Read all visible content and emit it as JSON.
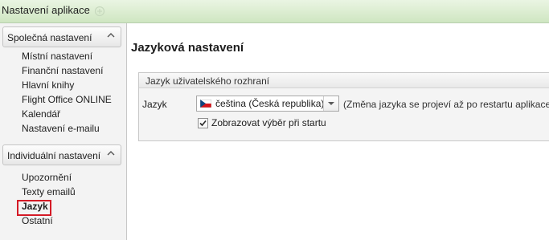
{
  "window": {
    "title": "Nastavení aplikace"
  },
  "sidebar": {
    "groups": [
      {
        "title": "Společná nastavení",
        "items": [
          {
            "label": "Místní nastavení"
          },
          {
            "label": "Finanční nastavení"
          },
          {
            "label": "Hlavní knihy"
          },
          {
            "label": "Flight Office ONLINE"
          },
          {
            "label": "Kalendář"
          },
          {
            "label": "Nastavení e-mailu"
          }
        ]
      },
      {
        "title": "Individuální nastavení",
        "items": [
          {
            "label": "Upozornění"
          },
          {
            "label": "Texty emailů"
          },
          {
            "label": "Jazyk",
            "selected": true
          },
          {
            "label": "Ostatní"
          }
        ]
      }
    ]
  },
  "main": {
    "title": "Jazyková nastavení",
    "panel": {
      "title": "Jazyk uživatelského rozhraní",
      "language_label": "Jazyk",
      "language_value": "čeština (Česká republika)",
      "language_flag_icon": "czech-flag-icon",
      "hint": "(Změna jazyka se projeví až po restartu aplikace.)",
      "show_on_start_label": "Zobrazovat výběr při startu",
      "show_on_start_checked": true
    }
  },
  "colors": {
    "titlebar": "#d8ecce",
    "selection_highlight": "#d41a26"
  }
}
